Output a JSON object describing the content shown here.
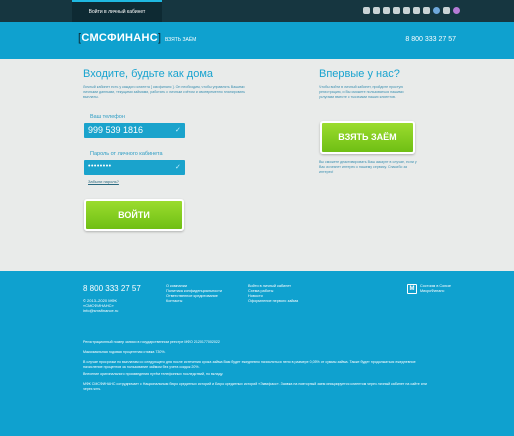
{
  "topbar": {
    "tab_label": "Войти в личный кабинет",
    "social_icons": [
      "android-icon",
      "apple-icon",
      "windows-icon",
      "vk-icon",
      "facebook-icon",
      "twitter-icon",
      "skype-icon",
      "odnoklassniki-icon",
      "mail-icon",
      "instagram-icon"
    ]
  },
  "header": {
    "logo_brand": "СМСФИНАНС",
    "nav_link": "ВЗЯТЬ ЗАЁМ",
    "phone": "8 800 333 27 57"
  },
  "login": {
    "title": "Входите, будьте как дома",
    "intro": "Личный кабинет есть у каждого клиента [ смсфинанс ]. Он необходим, чтобы управлять Вашими личными данными, текущими займами, работать с личным счётом и своевременно планировать выплаты.",
    "phone_label": "Ваш телефон",
    "phone_value": "999 539 1816",
    "password_label": "Пароль от личного кабинета",
    "password_value": "••••••••",
    "forgot_link": "Забыли пароль?",
    "submit": "ВОЙТИ"
  },
  "newcomer": {
    "title": "Впервые у нас?",
    "intro": "Чтобы войти в личный кабинет, пройдите простую регистрацию, и Вы сможете пользоваться нашими услугами вместе с тысячами наших клиентов.",
    "cta": "ВЗЯТЬ ЗАЁМ",
    "note": "Вы сможете деактивировать Ваш аккаунт в случае, если у Вас исчезнет интерес к нашему сервису. Спасибо за интерес!"
  },
  "footer": {
    "phone": "8 800 333 27 57",
    "copyright": [
      "© 2013–2020 МФК",
      "«СМСФИНАНС»",
      "info@smsfinance.ru"
    ],
    "col1": [
      "О компании",
      "Политика конфиденциальности",
      "Ответственное кредитование",
      "Контакты"
    ],
    "col2": [
      "Войти в личный кабинет",
      "Схема работы",
      "Новости",
      "Оформление первого займа"
    ],
    "badge_mark": "М",
    "badge_text": [
      "Состоим в Союзе",
      "МикроФинанс"
    ],
    "legal": [
      "Регистрационный номер записи в государственном реестре МФО 2120177002022",
      "Максимальная годовая процентная ставка 730%.",
      "В случае просрочки по выплатам со следующего дня после истечения срока займа Вам будет ежедневно начисляться пеня в размере 0,05% от суммы займа. Также будет продолжаться ежедневное начисление процентов за пользование займом без учета скидок 20%.",
      "Внесение оригинального произведения путём телефонных последствий, по вкладу.",
      "МФК СМСФИНАНС сотрудничает с Национальным бюро кредитных историй и Бюро кредитных историй «Эквифакс». Заявка на повторный заем инициируется клиентом через личный кабинет на сайте или через sms."
    ]
  }
}
